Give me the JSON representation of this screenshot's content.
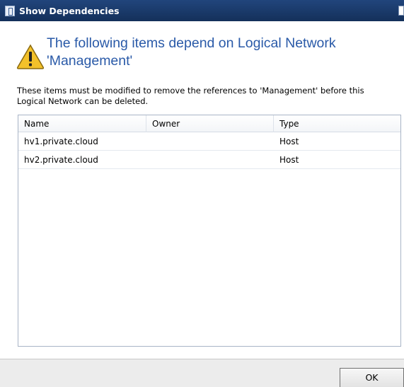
{
  "window": {
    "title": "Show Dependencies"
  },
  "message": {
    "heading_line1": "The following items depend on Logical Network",
    "heading_line2": "'Management'",
    "description_line1": "These items must be modified to remove the references to 'Management' before this",
    "description_line2": "Logical Network can be deleted.",
    "icon": "warning-icon"
  },
  "table": {
    "columns": [
      "Name",
      "Owner",
      "Type"
    ],
    "rows": [
      {
        "name": "hv1.private.cloud",
        "owner": "",
        "type": "Host"
      },
      {
        "name": "hv2.private.cloud",
        "owner": "",
        "type": "Host"
      }
    ]
  },
  "footer": {
    "ok_label": "OK"
  },
  "colors": {
    "title_bar": "#1c3d6e",
    "heading": "#2a5aa8",
    "warning": "#f3c12a"
  }
}
